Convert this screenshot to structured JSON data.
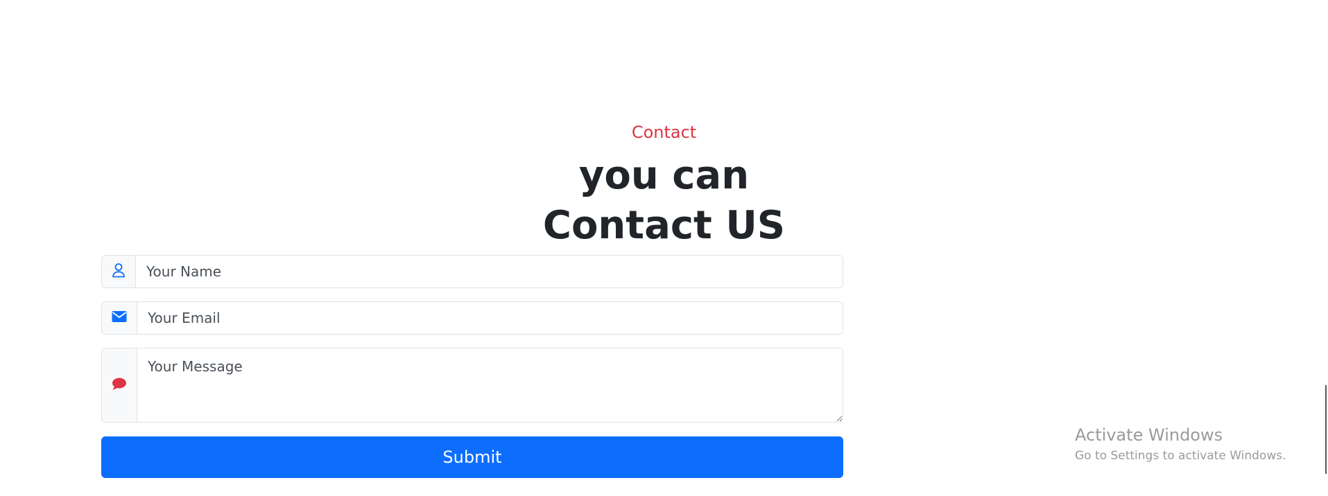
{
  "section": {
    "eyebrow": "Contact",
    "headline_line1": "you can",
    "headline_line2": "Contact US"
  },
  "form": {
    "name": {
      "placeholder": "Your Name",
      "value": "",
      "icon": "person-icon"
    },
    "email": {
      "placeholder": "Your Email",
      "value": "",
      "icon": "envelope-icon"
    },
    "message": {
      "placeholder": "Your Message",
      "value": "",
      "icon": "chat-bubble-icon"
    },
    "submit_label": "Submit"
  },
  "watermark": {
    "title": "Activate Windows",
    "subtitle": "Go to Settings to activate Windows."
  },
  "colors": {
    "accent_red": "#dc3545",
    "primary_blue": "#0d6efd",
    "heading": "#212529",
    "border": "#dee2e6"
  }
}
